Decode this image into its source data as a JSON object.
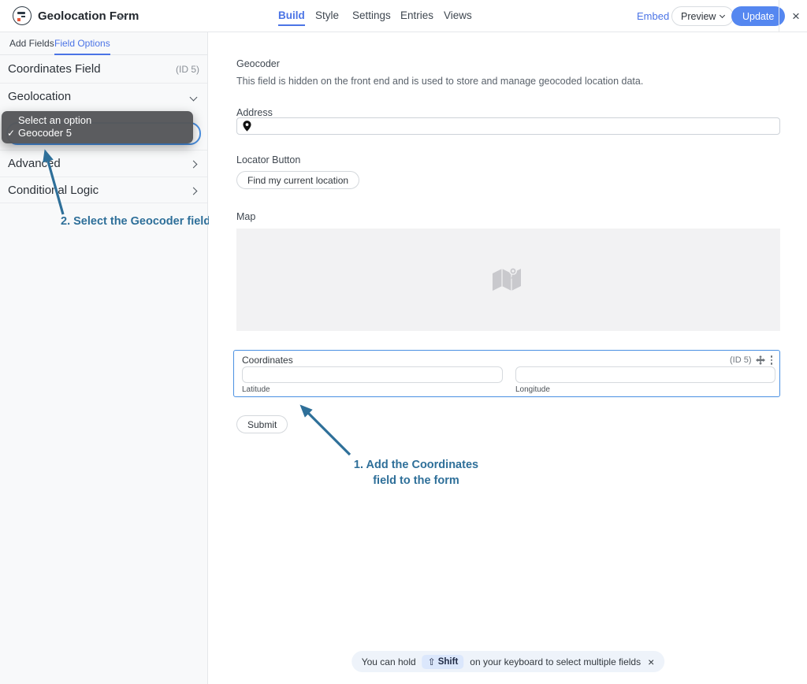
{
  "colors": {
    "accent_blue": "#4b74e6",
    "update_button_blue": "#5587f0",
    "annotation_blue": "#2e6f99",
    "selected_field_border": "#4a90e2",
    "sidebar_bg": "#f8f9fa",
    "toast_bg": "#eef3fa",
    "shift_badge_bg": "#dbe7fc",
    "dropdown_bg": "#58595c",
    "map_placeholder_bg": "#f2f2f3"
  },
  "header": {
    "title": "Geolocation Form",
    "tabs": [
      {
        "label": "Build",
        "active": true
      },
      {
        "label": "Style",
        "active": false
      },
      {
        "label": "Settings",
        "active": false
      },
      {
        "label": "Entries",
        "active": false
      },
      {
        "label": "Views",
        "active": false
      }
    ],
    "embed": "Embed",
    "preview": "Preview",
    "update": "Update",
    "close": "×"
  },
  "sidebar": {
    "tabs": [
      {
        "label": "Add Fields",
        "active": false
      },
      {
        "label": "Field Options",
        "active": true
      }
    ],
    "field_title": "Coordinates Field",
    "field_id": "(ID 5)",
    "sections": {
      "geolocation": "Geolocation",
      "advanced": "Advanced",
      "conditional": "Conditional Logic"
    },
    "dropdown": {
      "option_1": "Select an option",
      "option_2": "Geocoder 5",
      "check": "✓"
    },
    "annotation": "2. Select the Geocoder field"
  },
  "main": {
    "geocoder_label": "Geocoder",
    "geocoder_description": "This field is hidden on the front end and is used to store and manage geocoded location data.",
    "address_label": "Address",
    "address_value": "",
    "locator_label": "Locator Button",
    "locator_button": "Find my current location",
    "map_label": "Map",
    "coordinates": {
      "label": "Coordinates",
      "field_id": "(ID 5)",
      "latitude_label": "Latitude",
      "latitude_value": "",
      "longitude_label": "Longitude",
      "longitude_value": ""
    },
    "submit": "Submit",
    "annotation_line1": "1. Add the Coordinates",
    "annotation_line2": "field to the form"
  },
  "toast": {
    "text_before": "You can hold",
    "shift_symbol": "⇧",
    "shift_label": "Shift",
    "text_after": "on your keyboard to select multiple fields",
    "close": "×"
  }
}
